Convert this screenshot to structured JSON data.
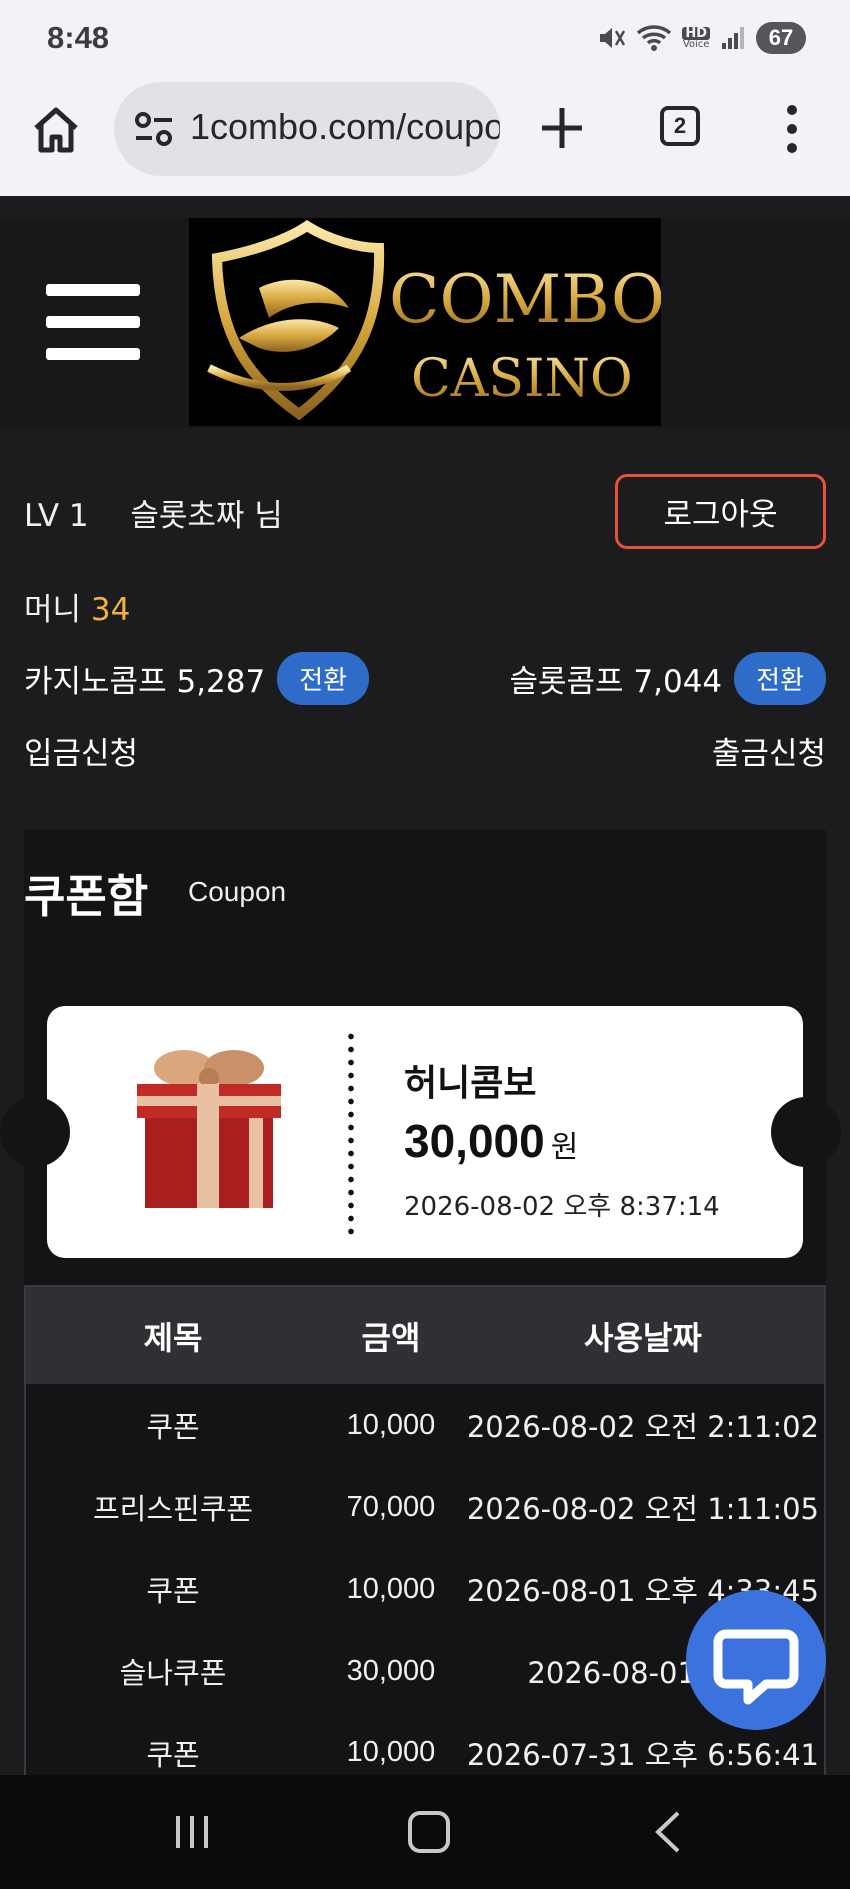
{
  "status_bar": {
    "time": "8:48",
    "battery": "67",
    "hd_label": "HD",
    "voice_label": "Voice"
  },
  "browser": {
    "url": "1combo.com/coupon",
    "tab_count": "2"
  },
  "header": {
    "logo_line1": "COMBO",
    "logo_line2": "CASINO"
  },
  "user": {
    "level": "LV 1",
    "name": "슬롯초짜 님",
    "logout_label": "로그아웃",
    "money_label": "머니",
    "money_value": "34",
    "casino_comp_label": "카지노콤프",
    "casino_comp_value": "5,287",
    "slot_comp_label": "슬롯콤프",
    "slot_comp_value": "7,044",
    "convert_label": "전환",
    "deposit_label": "입금신청",
    "withdraw_label": "출금신청"
  },
  "coupon": {
    "title": "쿠폰함",
    "subtitle": "Coupon",
    "ticket": {
      "name": "허니콤보",
      "amount": "30,000",
      "unit": "원",
      "date": "2026-08-02 오후 8:37:14"
    },
    "table": {
      "headers": [
        "제목",
        "금액",
        "사용날짜"
      ],
      "rows": [
        {
          "title": "쿠폰",
          "amount": "10,000",
          "date": "2026-08-02 오전 2:11:02"
        },
        {
          "title": "프리스핀쿠폰",
          "amount": "70,000",
          "date": "2026-08-02 오전 1:11:05"
        },
        {
          "title": "쿠폰",
          "amount": "10,000",
          "date": "2026-08-01 오후 4:33:45"
        },
        {
          "title": "슬나쿠폰",
          "amount": "30,000",
          "date": "2026-08-01 오전"
        },
        {
          "title": "쿠폰",
          "amount": "10,000",
          "date": "2026-07-31 오후 6:56:41"
        }
      ]
    }
  },
  "colors": {
    "accent_gold": "#f2b33b",
    "convert_blue": "#2f6bc8",
    "logout_border": "#e8513a",
    "chat_blue": "#3c72de"
  }
}
